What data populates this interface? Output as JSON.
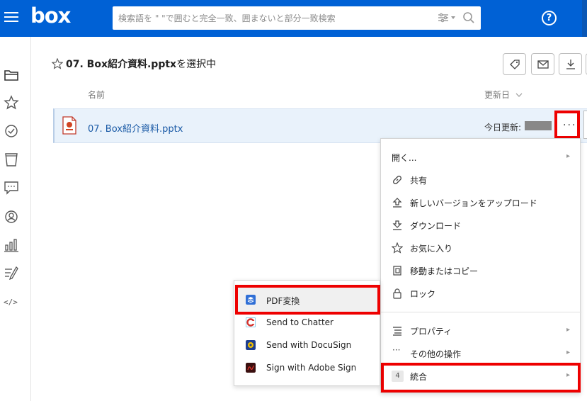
{
  "topbar": {
    "logo": "box",
    "search_placeholder": "検索語を \" \"で囲むと完全一致、囲まないと部分一致検索",
    "help_label": "?",
    "brand_color": "#0061d5"
  },
  "leftnav": {
    "icons": [
      "folder-icon",
      "star-icon",
      "check-circle-icon",
      "trash-icon",
      "chat-icon",
      "user-circle-icon",
      "chart-icon",
      "notes-icon",
      "code-icon"
    ],
    "code_label": "</>"
  },
  "header": {
    "name": "07. Box紹介資料.pptx",
    "suffix": "を選択中"
  },
  "columns": {
    "name": "名前",
    "updated": "更新日",
    "sort_icon": "chevron-down-icon"
  },
  "file_row": {
    "file_name": "07. Box紹介資料.pptx",
    "updated_label": "今日更新:",
    "more_label": "···"
  },
  "context_menu": {
    "items": [
      {
        "label": "開く...",
        "icon": "none",
        "submenu": true
      },
      {
        "label": "共有",
        "icon": "link-icon",
        "submenu": false
      },
      {
        "label": "新しいバージョンをアップロード",
        "icon": "upload-icon",
        "submenu": false
      },
      {
        "label": "ダウンロード",
        "icon": "download-icon",
        "submenu": false
      },
      {
        "label": "お気に入り",
        "icon": "star-icon",
        "submenu": false
      },
      {
        "label": "移動またはコピー",
        "icon": "copy-icon",
        "submenu": false
      },
      {
        "label": "ロック",
        "icon": "lock-icon",
        "submenu": false
      },
      {
        "label": "プロパティ",
        "icon": "list-icon",
        "submenu": true
      },
      {
        "label": "その他の操作",
        "icon": "ellipsis-icon",
        "submenu": true
      },
      {
        "label": "統合",
        "icon": "badge",
        "badge": "4",
        "submenu": true
      }
    ]
  },
  "integration_submenu": {
    "items": [
      {
        "label": "PDF変換",
        "icon": "pdf-convert-icon",
        "color": "#2f6fd6"
      },
      {
        "label": "Send to Chatter",
        "icon": "chatter-icon",
        "color": "#d6322c"
      },
      {
        "label": "Send with DocuSign",
        "icon": "docusign-icon",
        "color": "#f2c000"
      },
      {
        "label": "Sign with Adobe Sign",
        "icon": "adobe-sign-icon",
        "color": "#b31e1e"
      }
    ]
  },
  "highlight_color": "#ee0000"
}
